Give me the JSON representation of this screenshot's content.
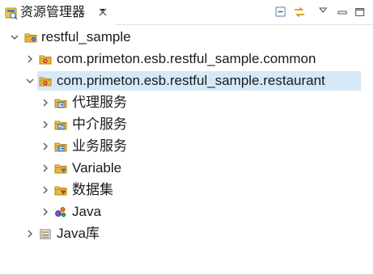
{
  "view": {
    "title": "资源管理器",
    "icon": "explorer-view-icon",
    "close_icon": "close-icon",
    "toolbar": [
      {
        "name": "collapse-all-icon"
      },
      {
        "name": "link-with-editor-icon"
      },
      {
        "name": "view-menu-icon"
      },
      {
        "name": "minimize-icon"
      },
      {
        "name": "maximize-icon"
      }
    ]
  },
  "tree": [
    {
      "label": "restful_sample",
      "expanded": true,
      "icon": "project-folder-icon"
    },
    {
      "label": "com.primeton.esb.restful_sample.common",
      "expanded": false,
      "icon": "module-icon"
    },
    {
      "label": "com.primeton.esb.restful_sample.restaurant",
      "expanded": true,
      "selected": true,
      "icon": "module-icon"
    },
    {
      "label": "代理服务",
      "expanded": false,
      "icon": "proxy-service-folder-icon"
    },
    {
      "label": "中介服务",
      "expanded": false,
      "icon": "mediation-service-folder-icon"
    },
    {
      "label": "业务服务",
      "expanded": false,
      "icon": "business-service-folder-icon"
    },
    {
      "label": "Variable",
      "expanded": false,
      "icon": "variable-folder-icon"
    },
    {
      "label": "数据集",
      "expanded": false,
      "icon": "dataset-folder-icon"
    },
    {
      "label": "Java",
      "expanded": false,
      "icon": "java-source-icon"
    },
    {
      "label": "Java库",
      "expanded": false,
      "icon": "java-library-icon"
    }
  ],
  "colors": {
    "selection": "#d6e9f8",
    "folder": "#e8b94a",
    "arrow": "#6b6b6b"
  }
}
